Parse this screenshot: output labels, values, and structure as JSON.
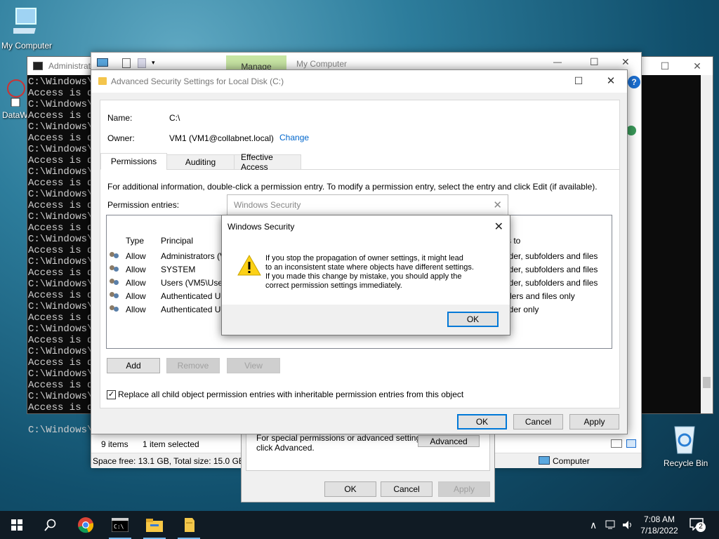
{
  "desktop": {
    "my_computer": "My Computer",
    "dataw": "DataW",
    "recycle_bin": "Recycle Bin"
  },
  "cmd": {
    "title": "Administrat",
    "lines": [
      "C:\\Windows\\",
      "Access is de",
      "C:\\Windows\\",
      "Access is de",
      "C:\\Windows\\",
      "Access is de",
      "C:\\Windows\\",
      "Access is de",
      "C:\\Windows\\",
      "Access is de",
      "C:\\Windows\\",
      "Access is de",
      "C:\\Windows\\",
      "Access is de",
      "C:\\Windows\\",
      "Access is de",
      "C:\\Windows\\",
      "Access is de",
      "C:\\Windows\\",
      "Access is de",
      "C:\\Windows\\",
      "Access is de",
      "C:\\Windows\\",
      "Access is de",
      "C:\\Windows\\",
      "Access is de",
      "C:\\Windows\\",
      "Access is de",
      "C:\\Windows\\",
      "Access is de",
      "",
      "C:\\Windows\\"
    ]
  },
  "explorer": {
    "manage": "Manage",
    "title": "My Computer",
    "items": "9 items",
    "selected": "1 item selected",
    "space": "Space free: 13.1 GB, Total size: 15.0 GB",
    "computer": "Computer"
  },
  "props": {
    "special": "For special permissions or advanced settings,",
    "click_adv": "click Advanced.",
    "advanced": "Advanced",
    "ok": "OK",
    "cancel": "Cancel",
    "apply": "Apply"
  },
  "adv": {
    "title": "Advanced Security Settings for Local Disk (C:)",
    "name_label": "Name:",
    "name_value": "C:\\",
    "owner_label": "Owner:",
    "owner_value": "VM1 (VM1@collabnet.local)",
    "change": "Change",
    "tabs": [
      "Permissions",
      "Auditing",
      "Effective Access"
    ],
    "info": "For additional information, double-click a permission entry. To modify a permission entry, select the entry and click Edit (if available).",
    "entries_label": "Permission entries:",
    "col_type": "Type",
    "col_principal": "Principal",
    "col_applies": "s to",
    "rows": [
      {
        "type": "Allow",
        "principal": "Administrators (V",
        "applies": "lder, subfolders and files"
      },
      {
        "type": "Allow",
        "principal": "SYSTEM",
        "applies": "lder, subfolders and files"
      },
      {
        "type": "Allow",
        "principal": "Users (VM5\\User",
        "applies": "lder, subfolders and files"
      },
      {
        "type": "Allow",
        "principal": "Authenticated U",
        "applies": "ders and files only"
      },
      {
        "type": "Allow",
        "principal": "Authenticated U",
        "applies": "lder only"
      }
    ],
    "add": "Add",
    "remove": "Remove",
    "view": "View",
    "replace": "Replace all child object permission entries with inheritable permission entries from this object",
    "ok": "OK",
    "cancel": "Cancel",
    "apply": "Apply"
  },
  "security_back": {
    "title": "Windows Security"
  },
  "security": {
    "title": "Windows Security",
    "line1": "If you stop the propagation of owner settings, it might lead",
    "line2": "to an inconsistent state where objects have different settings.",
    "line3": "If you made this change by mistake, you should apply the",
    "line4": "correct permission settings immediately.",
    "ok": "OK"
  },
  "taskbar": {
    "time": "7:08 AM",
    "date": "7/18/2022",
    "notifications": "2"
  }
}
